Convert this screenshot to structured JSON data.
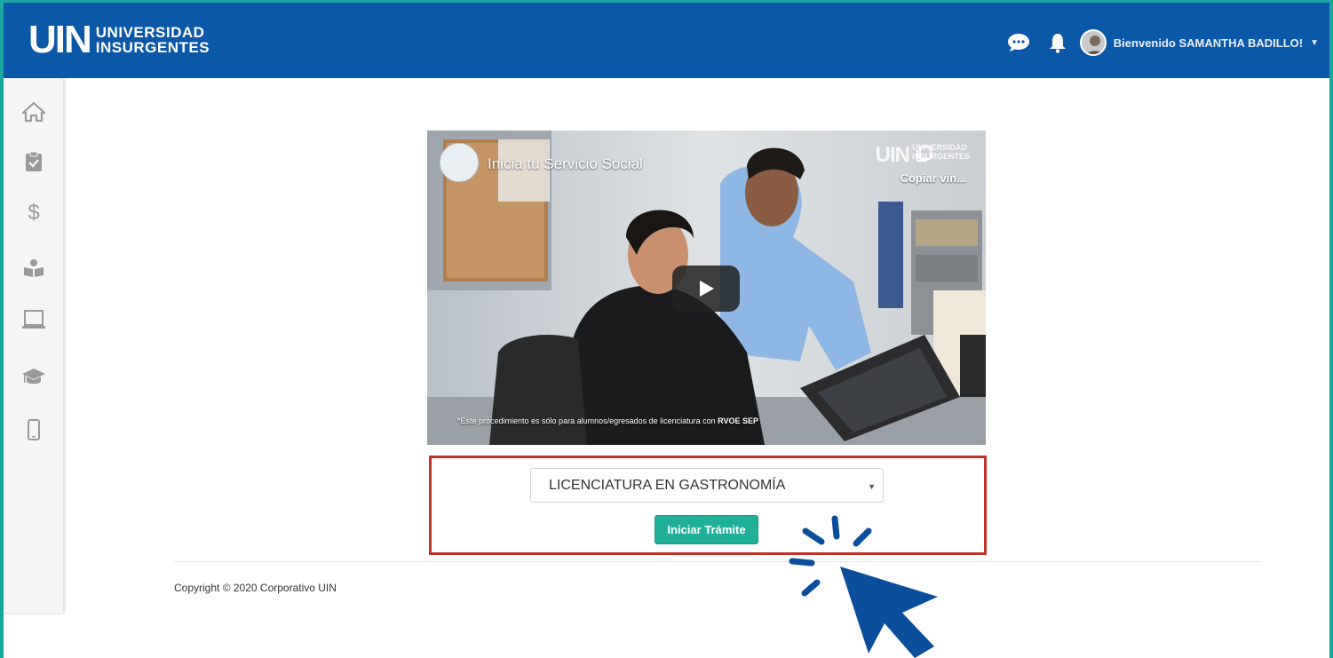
{
  "header": {
    "logo_mark": "UIN",
    "logo_line1": "UNIVERSIDAD",
    "logo_line2": "INSURGENTES",
    "welcome_text": "Bienvenido SAMANTHA BADILLO!",
    "icons": [
      "chat-icon",
      "bell-icon",
      "user-avatar",
      "caret-down-icon"
    ]
  },
  "sidebar": {
    "items": [
      {
        "icon": "home-icon"
      },
      {
        "icon": "clipboard-check-icon"
      },
      {
        "icon": "dollar-icon"
      },
      {
        "icon": "reader-icon"
      },
      {
        "icon": "laptop-icon"
      },
      {
        "icon": "graduation-cap-icon"
      },
      {
        "icon": "mobile-icon"
      }
    ]
  },
  "video": {
    "title": "Inicia tu Servicio Social",
    "copy_link": "Copiar vín...",
    "watermark_mark": "UIN",
    "watermark_line1": "UNIVERSIDAD",
    "watermark_line2": "INSURGENTES",
    "disclaimer_prefix": "*Este procedimiento es sólo para alumnos/egresados de licenciatura con ",
    "disclaimer_bold": "RVOE SEP"
  },
  "form": {
    "program_select_value": "LICENCIATURA EN GASTRONOMÍA",
    "start_button_label": "Iniciar Trámite"
  },
  "footer": {
    "copyright": "Copyright © 2020 Corporativo UIN"
  },
  "colors": {
    "header_bg": "#0b57a8",
    "frame_accent": "#1aa7a0",
    "button_bg": "#20b09a",
    "highlight_border": "#c0322a",
    "cursor": "#0b4f9c"
  }
}
